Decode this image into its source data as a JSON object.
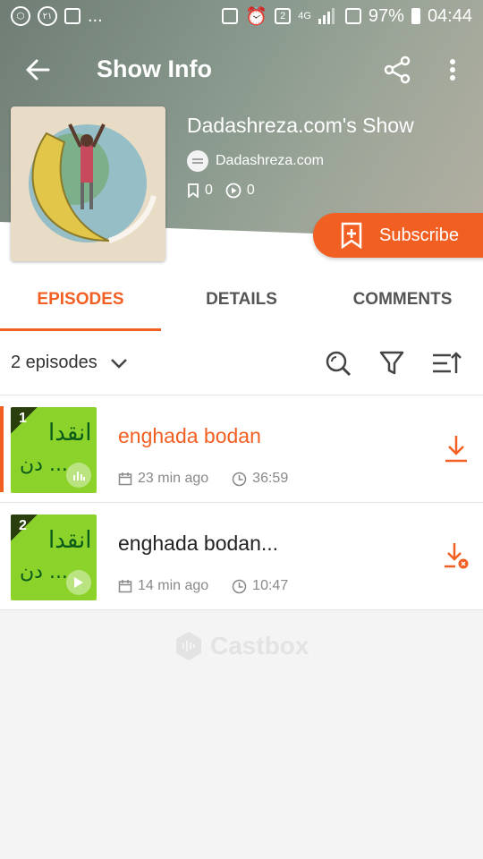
{
  "status_bar": {
    "left_badges": [
      "٢١"
    ],
    "ellipsis": "...",
    "sim_badge": "2",
    "network": "4G",
    "battery": "97%",
    "time": "04:44"
  },
  "toolbar": {
    "title": "Show Info"
  },
  "show": {
    "title": "Dadashreza.com's Show",
    "author": "Dadashreza.com",
    "bookmarks": "0",
    "plays": "0"
  },
  "subscribe": {
    "label": "Subscribe"
  },
  "tabs": [
    {
      "label": "EPISODES",
      "active": true
    },
    {
      "label": "DETAILS",
      "active": false
    },
    {
      "label": "COMMENTS",
      "active": false
    }
  ],
  "filter": {
    "episodes_count": "2 episodes"
  },
  "episodes": [
    {
      "num": "1",
      "thumb_line1": "انقدا",
      "thumb_line2": "دن ...",
      "title": "enghada bodan",
      "date": "23 min ago",
      "duration": "36:59",
      "playing": true
    },
    {
      "num": "2",
      "thumb_line1": "انقدا",
      "thumb_line2": "دن ...",
      "title": "enghada bodan...",
      "date": "14 min ago",
      "duration": "10:47",
      "playing": false
    }
  ],
  "footer": {
    "brand": "Castbox"
  },
  "colors": {
    "accent": "#f25f22",
    "thumb_green": "#8bd22b"
  }
}
